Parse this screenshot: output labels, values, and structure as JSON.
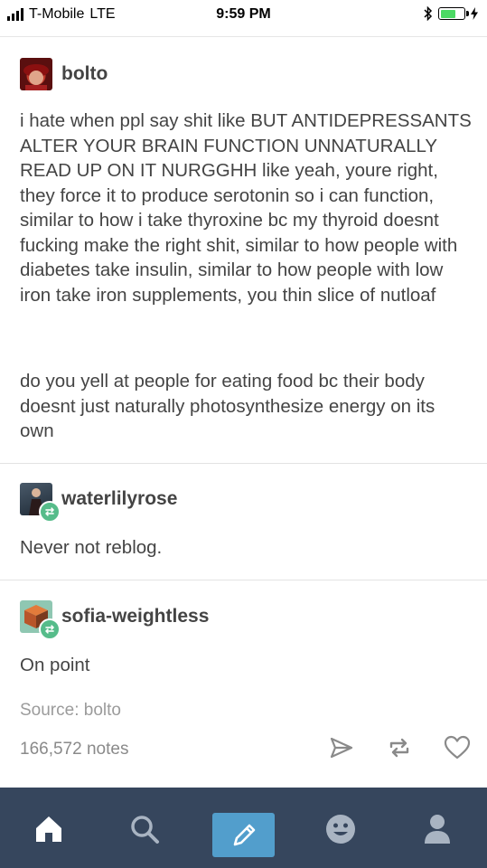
{
  "status_bar": {
    "carrier": "T-Mobile",
    "network": "LTE",
    "time": "9:59 PM"
  },
  "posts": [
    {
      "username": "bolto",
      "avatar_color": "#8a1c1c",
      "paragraphs": [
        "i hate when ppl say shit like BUT ANTIDEPRESSANTS ALTER YOUR BRAIN FUNCTION UNNATURALLY READ UP ON IT NURGGHH like yeah, youre right, they force it to produce serotonin so i can function, similar to how i take thyroxine bc my thyroid doesnt fucking make the right shit, similar to how people with diabetes take insulin, similar to how people with low iron take iron supplements, you thin slice of nutloaf",
        "do you yell at people for eating food bc their body doesnt just naturally photosynthesize energy on its own"
      ]
    },
    {
      "username": "waterlilyrose",
      "avatar_color": "#2c3a4a",
      "reblog": true,
      "text": "Never not reblog."
    },
    {
      "username": "sofia-weightless",
      "avatar_color": "#6aa08c",
      "reblog": true,
      "text": "On point"
    }
  ],
  "footer": {
    "source": "Source: bolto",
    "notes": "166,572 notes"
  },
  "icons": {
    "post_actions": [
      "share-icon",
      "reblog-icon",
      "heart-icon"
    ],
    "nav": [
      "home-icon",
      "search-icon",
      "compose-icon",
      "activity-icon",
      "account-icon"
    ]
  },
  "colors": {
    "nav_background": "#36465d",
    "compose_button": "#529ecc",
    "reblog_badge": "#56bc8a"
  }
}
